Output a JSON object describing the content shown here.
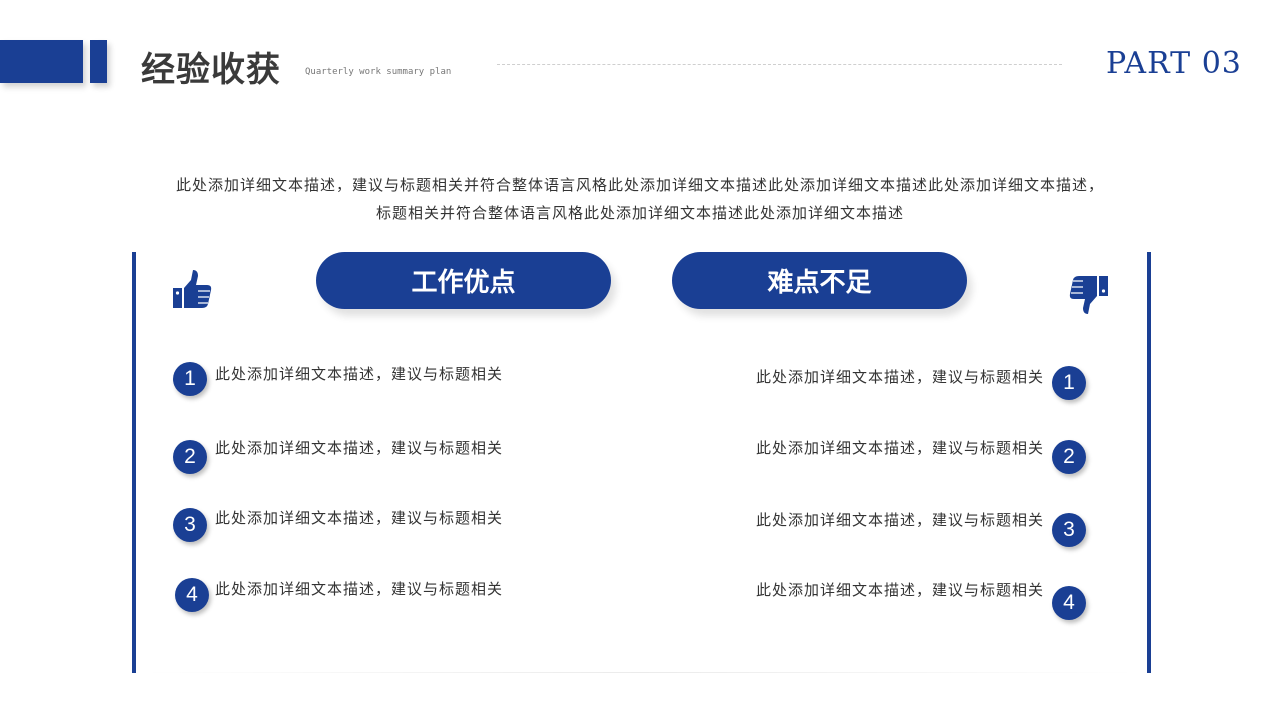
{
  "header": {
    "title": "经验收获",
    "subtitle": "Quarterly work summary plan",
    "part_label": "PART 03"
  },
  "intro": {
    "line1": "此处添加详细文本描述，建议与标题相关并符合整体语言风格此处添加详细文本描述此处添加详细文本描述此处添加详细文本描述，",
    "line2": "标题相关并符合整体语言风格此处添加详细文本描述此处添加详细文本描述"
  },
  "left": {
    "title": "工作优点",
    "icon": "thumbs-up-icon",
    "items": [
      {
        "number": "1",
        "text": "此处添加详细文本描述，建议与标题相关"
      },
      {
        "number": "2",
        "text": "此处添加详细文本描述，建议与标题相关"
      },
      {
        "number": "3",
        "text": "此处添加详细文本描述，建议与标题相关"
      },
      {
        "number": "4",
        "text": "此处添加详细文本描述，建议与标题相关"
      }
    ]
  },
  "right": {
    "title": "难点不足",
    "icon": "thumbs-down-icon",
    "items": [
      {
        "number": "1",
        "text": "此处添加详细文本描述，建议与标题相关"
      },
      {
        "number": "2",
        "text": "此处添加详细文本描述，建议与标题相关"
      },
      {
        "number": "3",
        "text": "此处添加详细文本描述，建议与标题相关"
      },
      {
        "number": "4",
        "text": "此处添加详细文本描述，建议与标题相关"
      }
    ]
  },
  "colors": {
    "accent": "#1a3f94",
    "text": "#333333",
    "title": "#3a3a3a"
  }
}
